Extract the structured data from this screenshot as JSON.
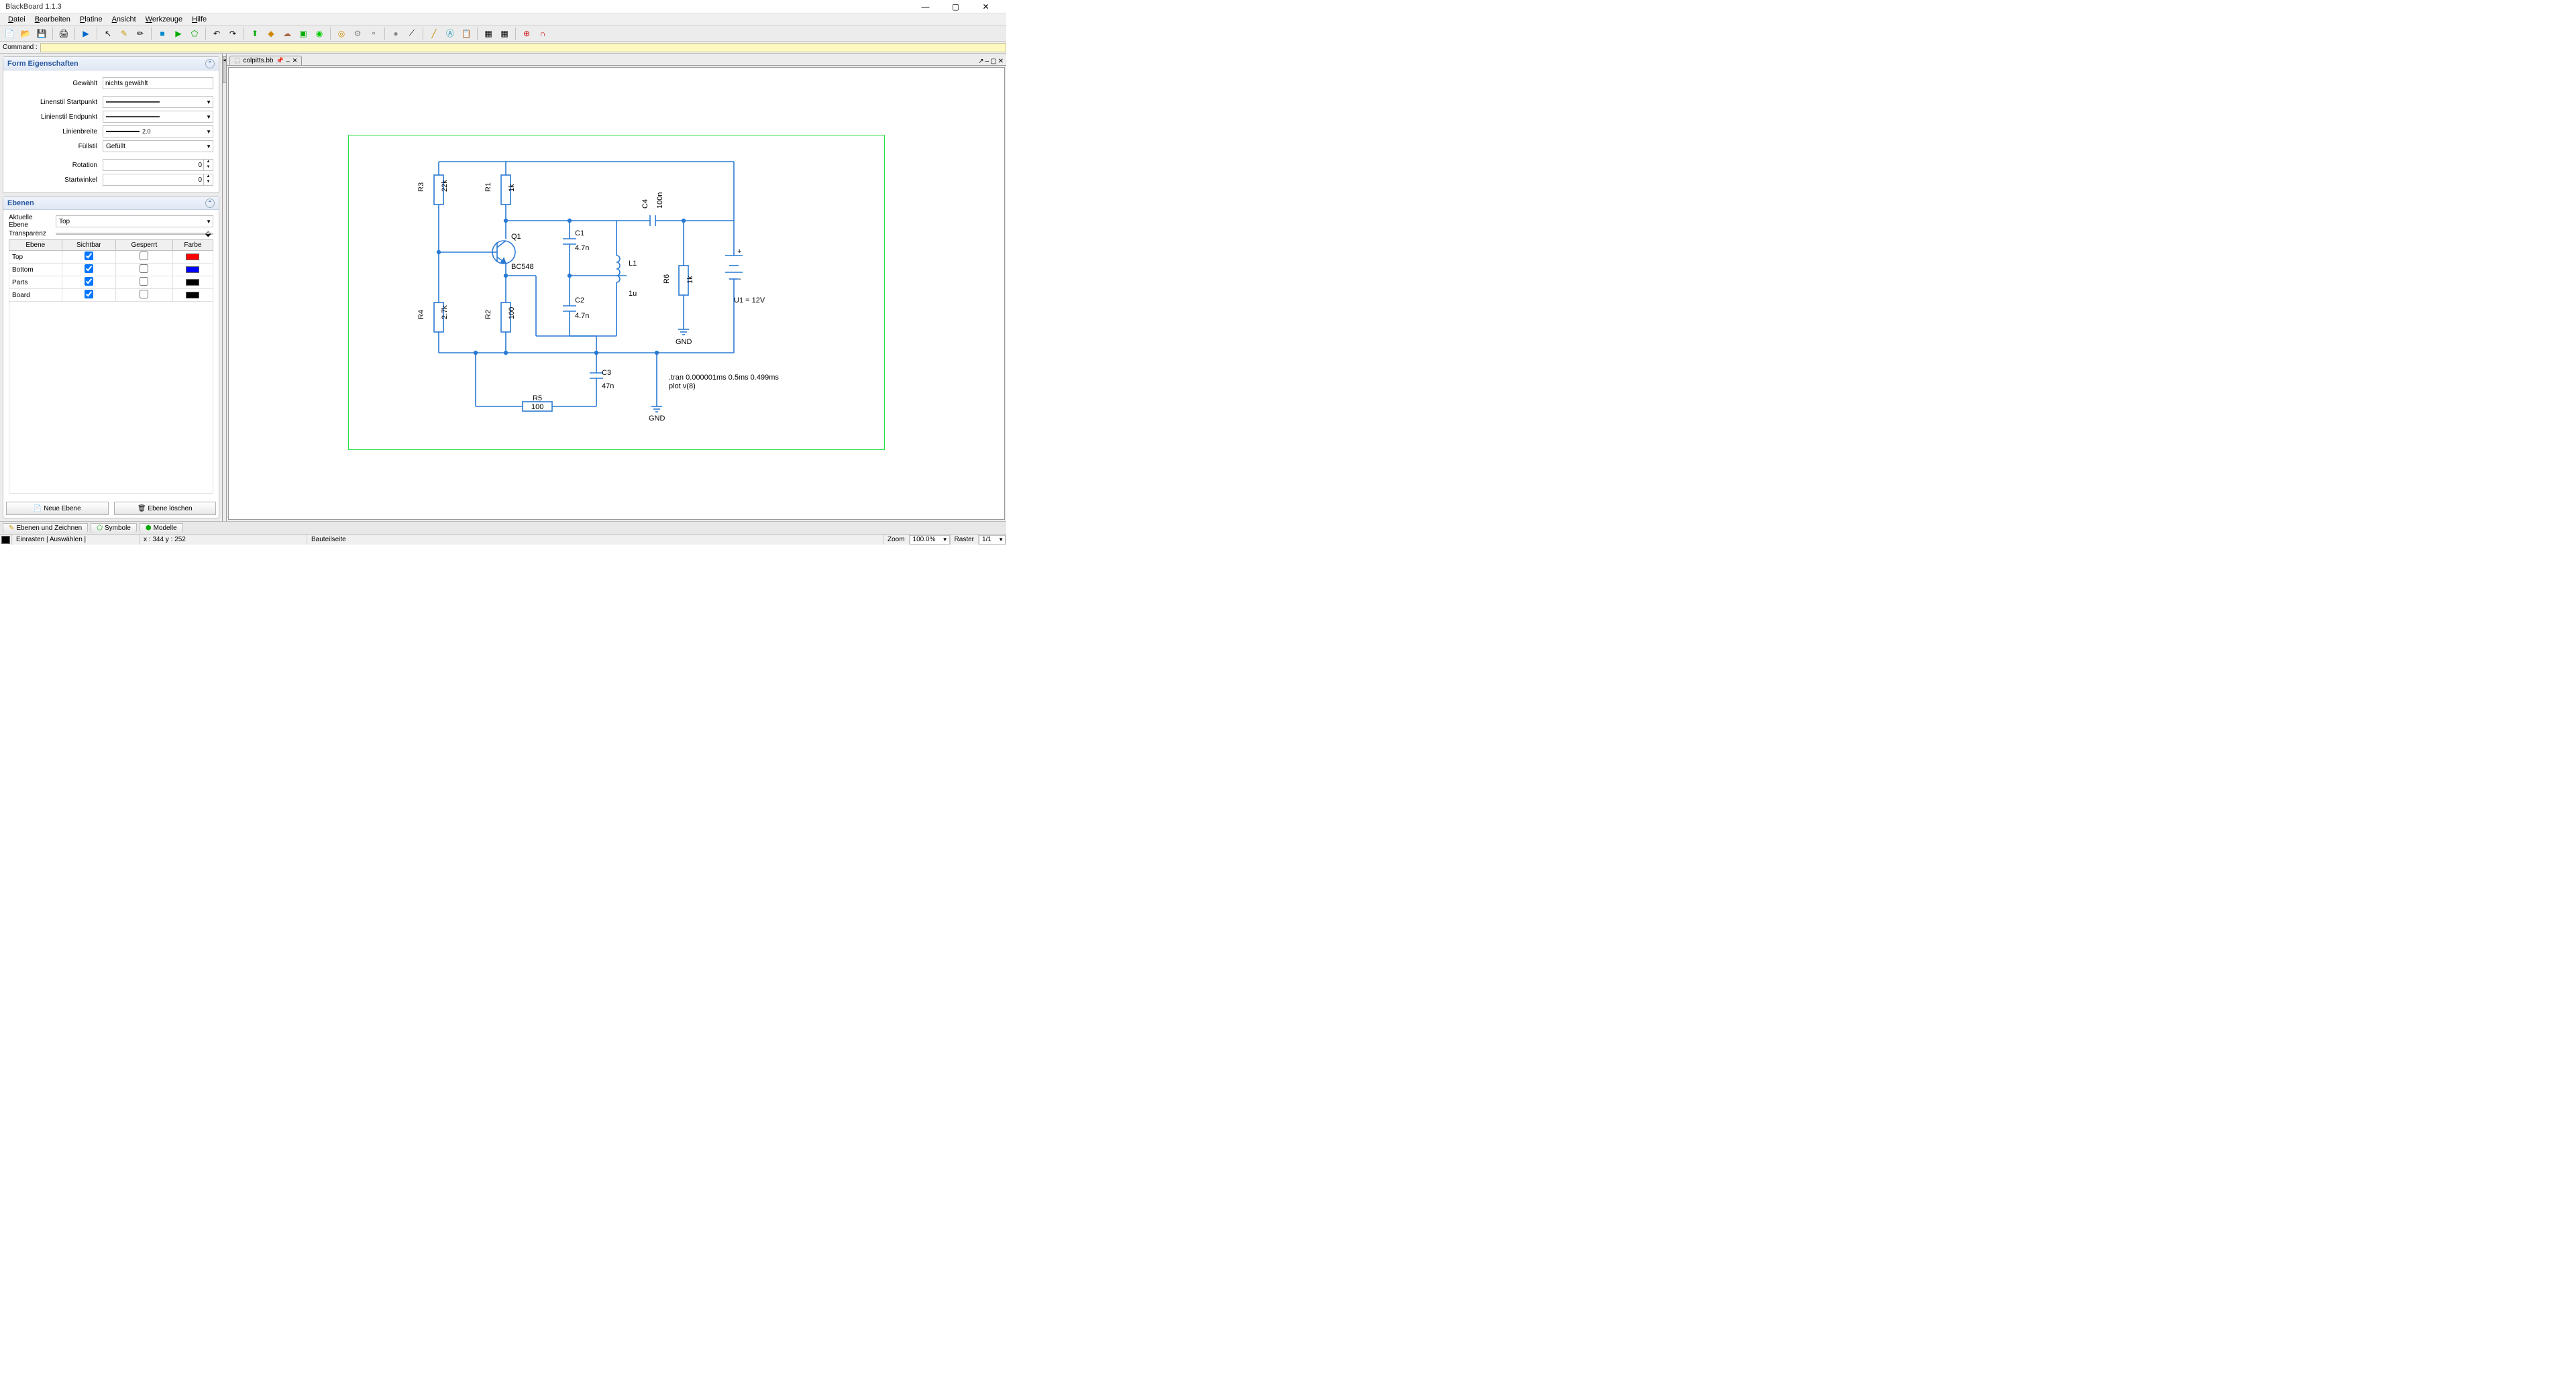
{
  "app": {
    "title": "BlackBoard 1.1.3"
  },
  "menu": [
    "Datei",
    "Bearbeiten",
    "Platine",
    "Ansicht",
    "Werkzeuge",
    "Hilfe"
  ],
  "command": {
    "label": "Command :"
  },
  "panels": {
    "form": {
      "title": "Form Eigenschaften",
      "rows": {
        "selected_lbl": "Gewählt",
        "selected_val": "nichts gewählt",
        "linestart_lbl": "Linenstil Startpunkt",
        "lineend_lbl": "Linienstil Endpunkt",
        "linewidth_lbl": "Linienbreite",
        "linewidth_val": "2.0",
        "fillstyle_lbl": "Füllstil",
        "fillstyle_val": "Gefüllt",
        "rotation_lbl": "Rotation",
        "rotation_val": "0",
        "startangle_lbl": "Startwinkel",
        "startangle_val": "0"
      }
    },
    "layers": {
      "title": "Ebenen",
      "current_lbl": "Aktuelle Ebene",
      "current_val": "Top",
      "transparency_lbl": "Transparenz",
      "cols": [
        "Ebene",
        "Sichtbar",
        "Gesperrt",
        "Farbe"
      ],
      "rows": [
        {
          "name": "Top",
          "visible": true,
          "locked": false,
          "color": "#ff0000"
        },
        {
          "name": "Bottom",
          "visible": true,
          "locked": false,
          "color": "#0000ff"
        },
        {
          "name": "Parts",
          "visible": true,
          "locked": false,
          "color": "#000000"
        },
        {
          "name": "Board",
          "visible": true,
          "locked": false,
          "color": "#000000"
        }
      ],
      "new_btn": "Neue Ebene",
      "del_btn": "Ebene löschen"
    }
  },
  "document": {
    "name": "colpitts.bb"
  },
  "schematic": {
    "R3": {
      "name": "R3",
      "value": "22k"
    },
    "R1": {
      "name": "R1",
      "value": "1k"
    },
    "R4": {
      "name": "R4",
      "value": "2.7k"
    },
    "R2": {
      "name": "R2",
      "value": "100"
    },
    "R5": {
      "name": "R5",
      "value": "100"
    },
    "R6": {
      "name": "R6",
      "value": "1k"
    },
    "Q1": {
      "name": "Q1",
      "value": "BC548"
    },
    "C1": {
      "name": "C1",
      "value": "4.7n"
    },
    "C2": {
      "name": "C2",
      "value": "4.7n"
    },
    "C3": {
      "name": "C3",
      "value": "47n"
    },
    "C4": {
      "name": "C4",
      "value": "100n"
    },
    "L1": {
      "name": "L1",
      "value": "1u"
    },
    "U1": "U1 = 12V",
    "GND": "GND",
    "sim1": ".tran 0.000001ms 0.5ms 0.499ms",
    "sim2": "plot v(8)"
  },
  "pagetabs": [
    "Ebenen und Zeichnen",
    "Symbole",
    "Modelle"
  ],
  "status": {
    "snap": "Einrasten | Auswählen |",
    "coords": "x : 344 y : 252",
    "side": "Bauteilseite",
    "zoom_lbl": "Zoom",
    "zoom_val": "100.0%",
    "raster_lbl": "Raster",
    "raster_val": "1/1"
  }
}
